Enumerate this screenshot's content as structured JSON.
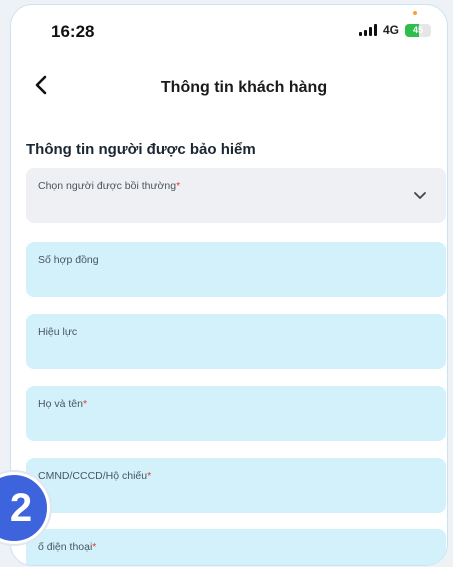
{
  "status_bar": {
    "time": "16:28",
    "network": "4G",
    "battery": "45"
  },
  "header": {
    "title": "Thông tin khách hàng"
  },
  "section": {
    "title": "Thông tin người được bảo hiểm"
  },
  "fields": [
    {
      "label": "Chọn người được bồi thường",
      "required": true,
      "type": "select"
    },
    {
      "label": "Số hợp đồng",
      "required": false,
      "type": "text"
    },
    {
      "label": "Hiệu lực",
      "required": false,
      "type": "text"
    },
    {
      "label": "Họ và tên",
      "required": true,
      "type": "text"
    },
    {
      "label": "CMND/CCCD/Hộ chiếu",
      "required": true,
      "type": "text"
    },
    {
      "label": "ố điện thoại",
      "required": true,
      "type": "text"
    }
  ],
  "required_mark": "*",
  "step_badge": "2",
  "colors": {
    "field_bg": "#d2f1fb",
    "select_bg": "#eef0f3",
    "badge": "#3d63dd",
    "required": "#e53935"
  }
}
